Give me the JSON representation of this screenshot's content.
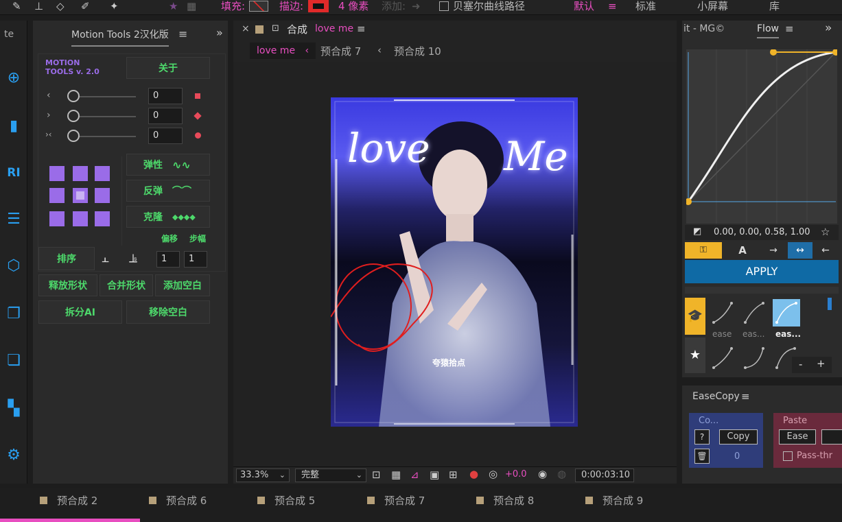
{
  "toolbar": {
    "fill_label": "填充:",
    "stroke_label": "描边:",
    "stroke_width": "4 像素",
    "add_label": "添加:",
    "bezier_label": "贝塞尔曲线路径",
    "workspaces": [
      "默认",
      "标准",
      "小屏幕",
      "库"
    ]
  },
  "left_tab": "te",
  "motion_tools": {
    "title": "Motion Tools 2汉化版",
    "logo_line1": "MOTION",
    "logo_line2": "TOOLS v. 2.0",
    "about": "关于",
    "sliders": [
      {
        "icon": "‹",
        "value": "0"
      },
      {
        "icon": "›",
        "value": "0"
      },
      {
        "icon": "›‹",
        "value": "0"
      }
    ],
    "elastic": "弹性",
    "bounce": "反弹",
    "clone": "克隆",
    "offset": "偏移",
    "step": "步幅",
    "sort": "排序",
    "count1": "1",
    "count2": "1",
    "release_shape": "释放形状",
    "merge_shape": "合并形状",
    "add_null": "添加空白",
    "split_ai": "拆分AI",
    "remove_null": "移除空白"
  },
  "comp": {
    "close": "×",
    "label_prefix": "合成",
    "name": "love me",
    "breadcrumb": [
      "love me",
      "预合成 7",
      "预合成 10"
    ],
    "zoom": "33.3%",
    "resolution": "完整",
    "exposure": "+0.0",
    "timecode": "0:00:03:10",
    "artwork_text": {
      "love": "love",
      "me": "Me",
      "watermark": "夸猿拾点"
    }
  },
  "flow": {
    "tab_left": "it - MG©",
    "title": "Flow",
    "curve_values": "0.00, 0.00, 0.58, 1.00",
    "apply": "APPLY",
    "presets": [
      "ease",
      "eas...",
      "eas..."
    ],
    "minus": "-",
    "plus": "+"
  },
  "easecopy": {
    "title": "EaseCopy",
    "copy_header": "Co...",
    "help": "?",
    "copy_btn": "Copy",
    "count": "0",
    "paste_header": "Paste",
    "ease_btn": "Ease",
    "passthru": "Pass-thr"
  },
  "bottom_tabs": [
    "预合成 2",
    "预合成 6",
    "预合成 5",
    "预合成 7",
    "预合成 8",
    "预合成 9"
  ]
}
